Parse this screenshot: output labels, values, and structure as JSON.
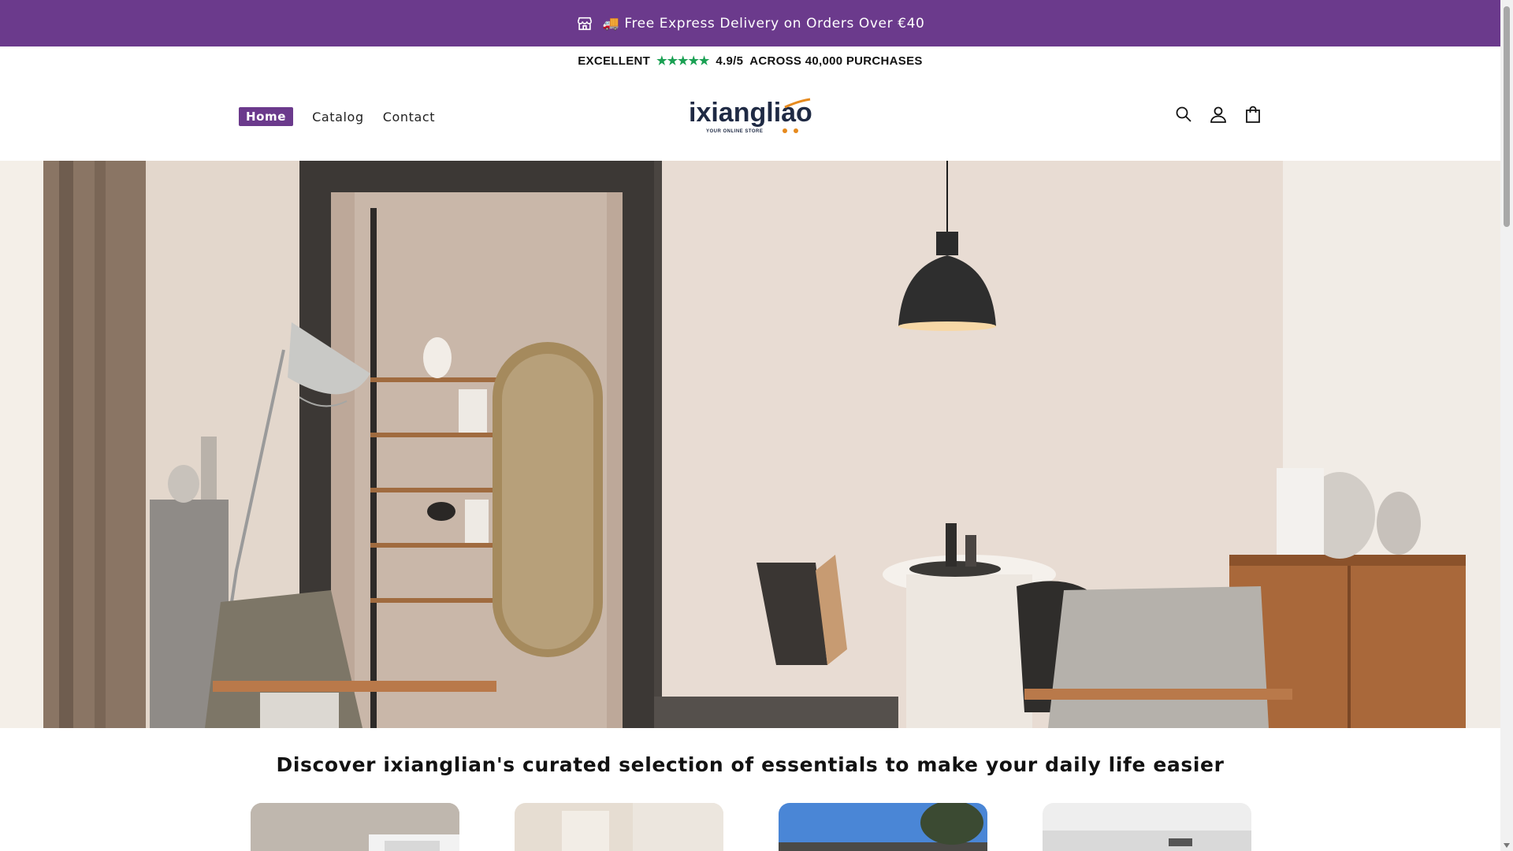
{
  "announcement": {
    "icon": "store-icon",
    "truck": "🚚",
    "text": "Free Express Delivery on Orders Over €40"
  },
  "rating": {
    "label": "EXCELLENT",
    "stars": "★★★★★",
    "score": "4.9/5",
    "suffix": "ACROSS 40,000 PURCHASES"
  },
  "nav": {
    "items": [
      {
        "label": "Home",
        "active": true
      },
      {
        "label": "Catalog",
        "active": false
      },
      {
        "label": "Contact",
        "active": false
      }
    ]
  },
  "logo": {
    "name": "ixiangliao",
    "subtitle": "YOUR ONLINE STORE"
  },
  "header_icons": [
    "search-icon",
    "account-icon",
    "cart-icon"
  ],
  "tagline": "Discover ixianglian's curated selection of essentials to make your daily life easier",
  "colors": {
    "brand": "#6b3a8c",
    "stars": "#1aa053",
    "logo_accent": "#e68a1e",
    "logo_text": "#1f2a44"
  }
}
